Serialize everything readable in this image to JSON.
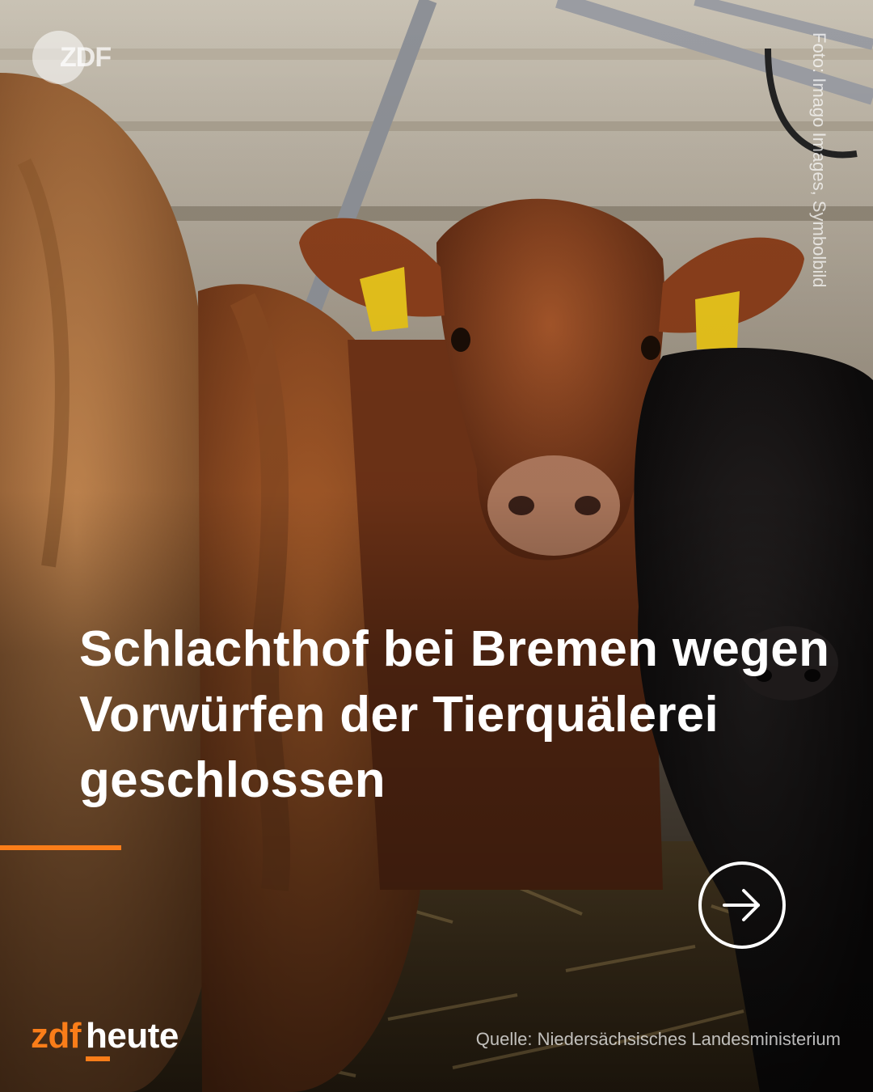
{
  "post": {
    "headline": "Schlachthof bei Bremen wegen Vorwürfen der Tierquälerei geschlossen",
    "photo_credit": "Foto: Imago Images, Symbolbild",
    "source": "Quelle: Niedersächsisches Landesministerium"
  },
  "branding": {
    "top_logo": "ZDF",
    "logo_part1": "zdf",
    "logo_part2": "heute",
    "accent_color": "#fa7d19"
  },
  "navigation": {
    "next_icon": "arrow-right-circle-icon"
  }
}
